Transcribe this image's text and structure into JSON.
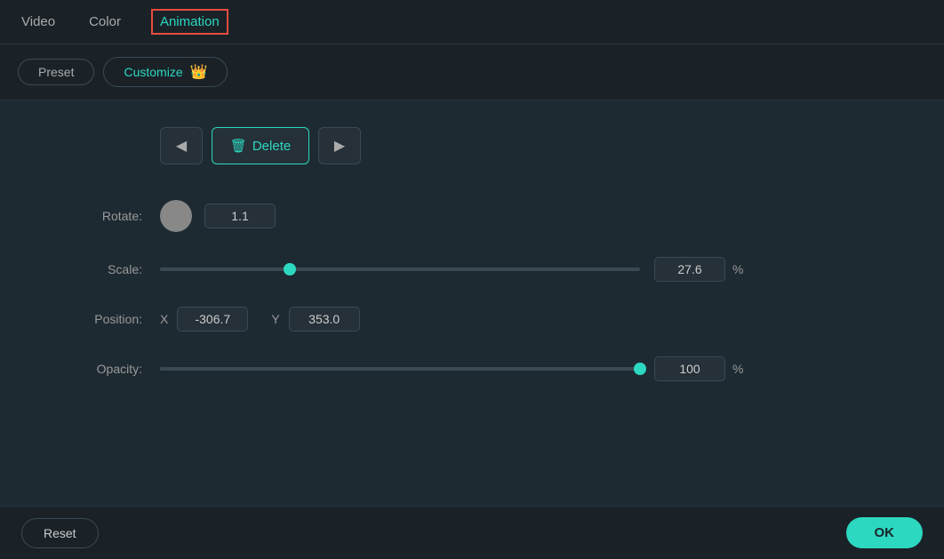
{
  "nav": {
    "tabs": [
      {
        "id": "video",
        "label": "Video",
        "active": false
      },
      {
        "id": "color",
        "label": "Color",
        "active": false
      },
      {
        "id": "animation",
        "label": "Animation",
        "active": true
      }
    ]
  },
  "subtabs": {
    "preset": {
      "label": "Preset",
      "active": false
    },
    "customize": {
      "label": "Customize",
      "active": true
    }
  },
  "crown": "👑",
  "actions": {
    "back_icon": "◀",
    "delete_icon": "🗑",
    "delete_label": "Delete",
    "forward_icon": "▶"
  },
  "controls": {
    "rotate": {
      "label": "Rotate:",
      "value": "1.1"
    },
    "scale": {
      "label": "Scale:",
      "value": "27.6",
      "unit": "%",
      "thumb_pct": 27
    },
    "position": {
      "label": "Position:",
      "x_label": "X",
      "x_value": "-306.7",
      "y_label": "Y",
      "y_value": "353.0"
    },
    "opacity": {
      "label": "Opacity:",
      "value": "100",
      "unit": "%",
      "thumb_pct": 100
    }
  },
  "footer": {
    "reset_label": "Reset",
    "ok_label": "OK"
  }
}
